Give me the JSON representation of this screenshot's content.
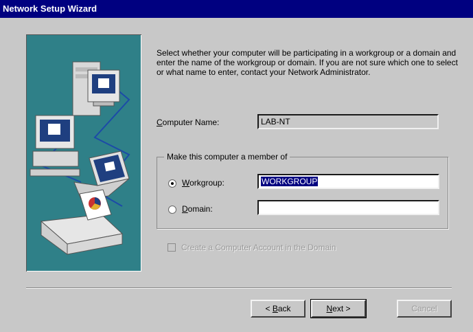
{
  "window": {
    "title": "Network Setup Wizard"
  },
  "description": "Select whether your computer will be participating in a workgroup or a domain and enter the name of the workgroup or domain. If you are not sure which one to select or what name to enter, contact your Network Administrator.",
  "computer_name": {
    "label_accel": "C",
    "label_rest": "omputer Name:",
    "value": "LAB-NT"
  },
  "membership": {
    "group_title": "Make this computer a member of",
    "workgroup": {
      "label_accel": "W",
      "label_rest": "orkgroup:",
      "value": "WORKGROUP",
      "checked": true
    },
    "domain": {
      "label_accel": "D",
      "label_rest": "omain:",
      "value": "",
      "checked": false
    }
  },
  "create_account": {
    "label": "Create a Computer Account in the Domain",
    "checked": false,
    "enabled": false
  },
  "buttons": {
    "back": {
      "prefix": "< ",
      "accel": "B",
      "rest": "ack"
    },
    "next": {
      "accel": "N",
      "rest": "ext",
      "suffix": " >"
    },
    "cancel": {
      "label": "Cancel",
      "enabled": false
    }
  },
  "colors": {
    "titlebar": "#000080",
    "art_background": "#2f8088",
    "dialog": "#c8c8c8"
  }
}
